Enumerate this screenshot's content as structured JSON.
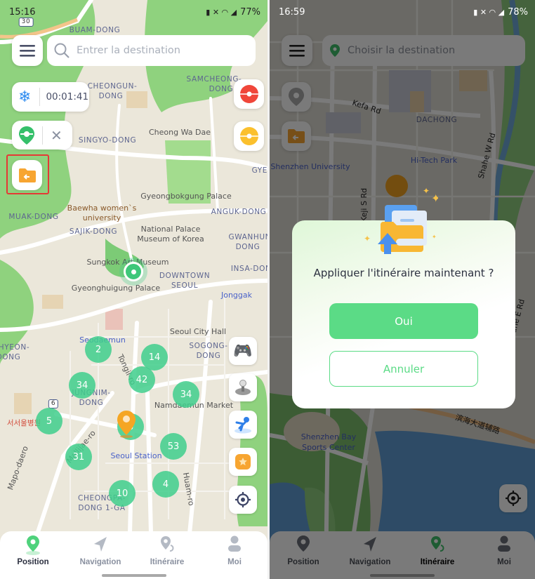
{
  "left_screen": {
    "status": {
      "time": "15:16",
      "battery": "77%"
    },
    "search": {
      "placeholder": "Entrer la destination"
    },
    "timer": "00:01:41",
    "map_labels": [
      "BUAM-DONG",
      "SAMCHEONG-",
      "DONG",
      "CHEONGUN-",
      "DONG",
      "Cheong Wa Dae",
      "SINGYO-DONG",
      "GYE-",
      "Gyeongbokgung Palace",
      "Baewha women`s",
      "university",
      "ANGUK-DONG",
      "MUAK-DONG",
      "SAJIK-DONG",
      "National Palace",
      "Museum of Korea",
      "GWANHUN-",
      "DONG",
      "Sungkok Art Museum",
      "INSA-DONG",
      "DOWNTOWN",
      "SEOUL",
      "Gyeonghuigung Palace",
      "Jonggak",
      "Seoul City Hall",
      "Seodaemun",
      "SOGONG-",
      "DONG",
      "HYEON-",
      "DONG",
      "Tongil-ro",
      "JUNGNIM-",
      "DONG",
      "Namdaemun Market",
      "서서울병원",
      "Seoul Station",
      "Mallijae-ro",
      "Mapo-daero",
      "Huam-ro",
      "CHEONGPA-",
      "DONG 1-GA",
      "30",
      "6"
    ],
    "clusters": [
      "2",
      "14",
      "42",
      "34",
      "34",
      "5",
      "8",
      "31",
      "53",
      "4",
      "10"
    ],
    "nav": {
      "active": "Position",
      "items": [
        "Position",
        "Navigation",
        "Itinéraire",
        "Moi"
      ]
    },
    "highlight_color": "#e53935"
  },
  "right_screen": {
    "status": {
      "time": "16:59",
      "battery": "78%"
    },
    "search": {
      "placeholder": "Choisir la destination"
    },
    "map_labels": [
      "Kefa Rd",
      "DACHONG",
      "Hi-Tech Park",
      "Shenzhen University",
      "Shahe W Rd",
      "Shahe E Rd",
      "Keji S Rd",
      "Shenzhen Bay",
      "Sports Center",
      "滨海大道辅路"
    ],
    "dialog": {
      "question": "Appliquer l'itinéraire maintenant ?",
      "confirm": "Oui",
      "cancel": "Annuler"
    },
    "nav": {
      "active": "Itinéraire",
      "items": [
        "Position",
        "Navigation",
        "Itinéraire",
        "Moi"
      ]
    }
  },
  "colors": {
    "accent": "#5bdb86",
    "cluster": "#40ce8c",
    "pin": "#f5a623"
  }
}
